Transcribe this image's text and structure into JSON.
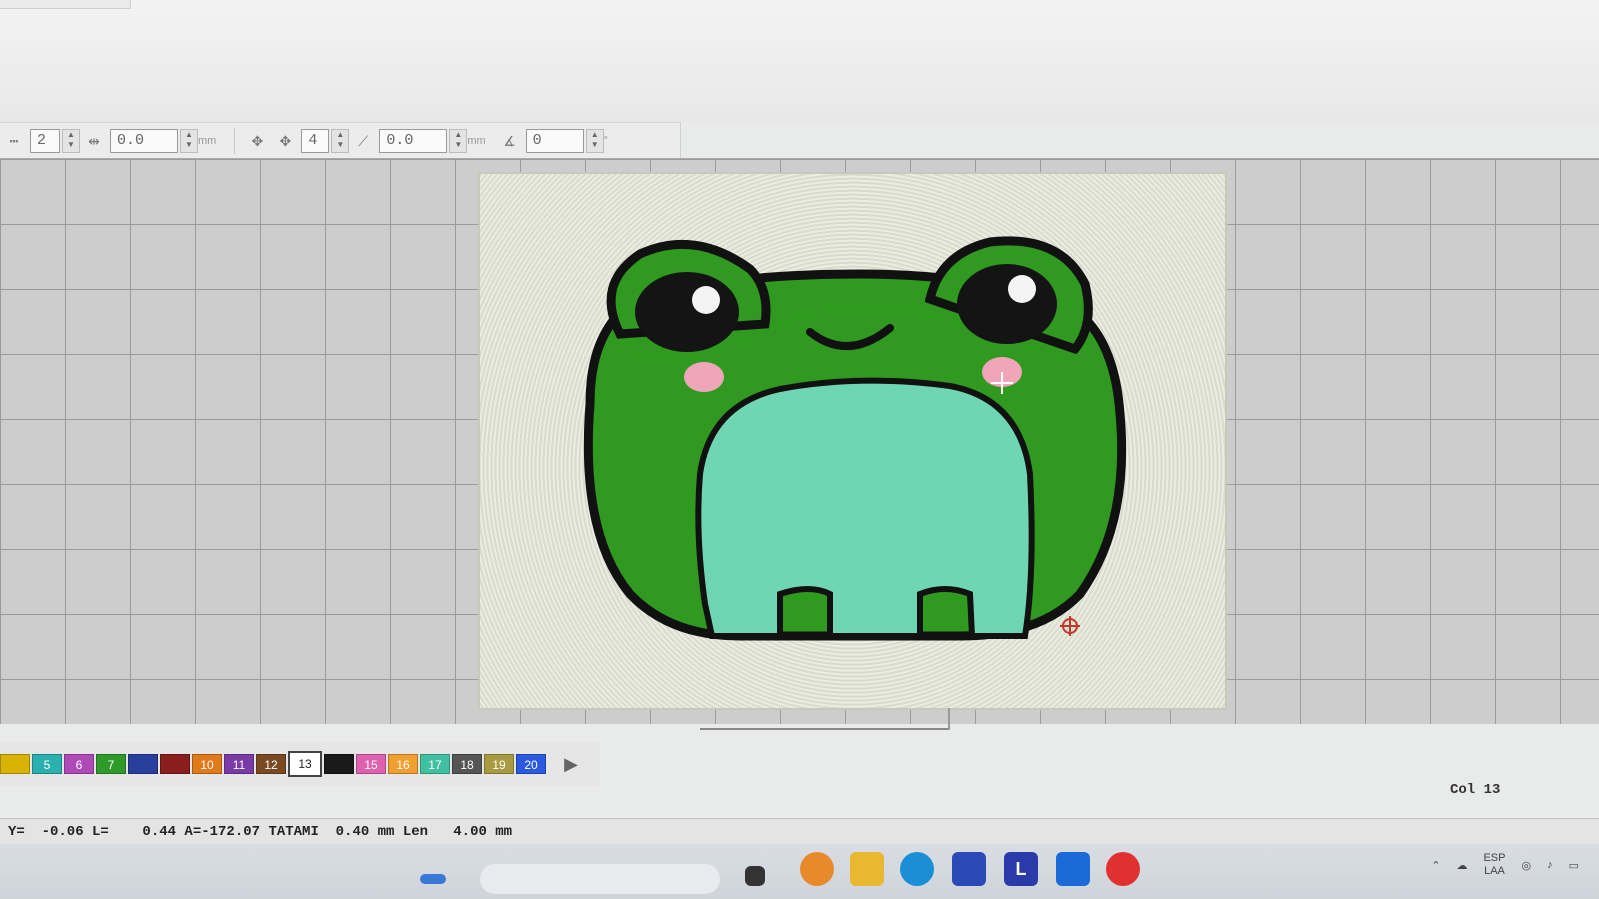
{
  "toolbar": {
    "field1_value": "2",
    "field2_value": "0.0",
    "unit_mm_1": "mm",
    "field3_value": "4",
    "field4_value": "0.0",
    "unit_mm_2": "mm",
    "field5_value": "0",
    "unit_deg": "°"
  },
  "palette": {
    "swatches": [
      {
        "label": "",
        "color": "#d8b400"
      },
      {
        "label": "5",
        "color": "#2bb0b0"
      },
      {
        "label": "6",
        "color": "#b04ab8"
      },
      {
        "label": "7",
        "color": "#2e9a2a"
      },
      {
        "label": "",
        "color": "#273e9c"
      },
      {
        "label": "",
        "color": "#8a1e1e"
      },
      {
        "label": "10",
        "color": "#e07a1a"
      },
      {
        "label": "11",
        "color": "#7a3aa8"
      },
      {
        "label": "12",
        "color": "#7a4a22"
      },
      {
        "label": "13",
        "color": "#ffffff"
      },
      {
        "label": "",
        "color": "#1a1a1a"
      },
      {
        "label": "15",
        "color": "#e060b0"
      },
      {
        "label": "16",
        "color": "#f0a030"
      },
      {
        "label": "17",
        "color": "#40c0a0"
      },
      {
        "label": "18",
        "color": "#555555"
      },
      {
        "label": "19",
        "color": "#a89a40"
      },
      {
        "label": "20",
        "color": "#2a5ae0"
      }
    ],
    "active_index": 9
  },
  "status": {
    "col_text": "Col 13",
    "line": "Y=  -0.06 L=    0.44 A=-172.07 TATAMI  0.40 mm Len   4.00 mm"
  },
  "taskbar": {
    "lang_top": "ESP",
    "lang_bottom": "LAA",
    "app_l_label": "L"
  },
  "colors": {
    "frog_green": "#2f9a1f",
    "frog_belly": "#6fd6b4",
    "outline": "#111111",
    "cheek": "#f0a6b8",
    "hoop_fabric": "#e6e7da"
  }
}
